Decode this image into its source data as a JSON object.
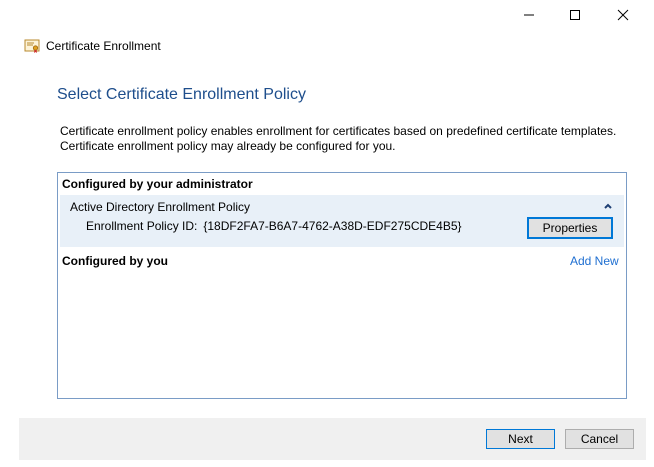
{
  "window": {
    "controls": {
      "minimize_icon": "minimize-icon",
      "maximize_icon": "maximize-icon",
      "close_icon": "close-icon"
    }
  },
  "header": {
    "icon": "certificate-icon",
    "title": "Certificate Enrollment"
  },
  "page": {
    "title": "Select Certificate Enrollment Policy",
    "description_line1": "Certificate enrollment policy enables enrollment for certificates based on predefined certificate templates.",
    "description_line2": "Certificate enrollment policy may already be configured for you."
  },
  "policy_list": {
    "admin_section_title": "Configured by your administrator",
    "admin_policy": {
      "name": "Active Directory Enrollment Policy",
      "id_label": "Enrollment Policy ID:",
      "id_value": "{18DF2FA7-B6A7-4762-A38D-EDF275CDE4B5}",
      "properties_label": "Properties"
    },
    "user_section_title": "Configured by you",
    "add_new_label": "Add New"
  },
  "footer": {
    "next_label": "Next",
    "cancel_label": "Cancel"
  },
  "colors": {
    "title_blue": "#1e4e8c",
    "link_blue": "#1f6fd1",
    "focus_blue": "#0078d7",
    "selected_row": "#e8f0f8",
    "footer_bg": "#f0f0f0"
  }
}
